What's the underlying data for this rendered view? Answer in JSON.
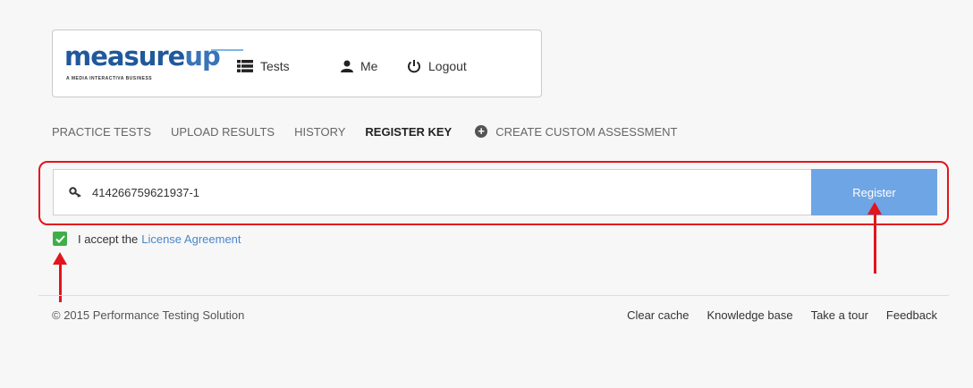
{
  "brand": {
    "logo_text_main": "measure",
    "logo_text_accent": "up",
    "logo_tagline": "A MEDIA INTERACTIVA BUSINESS"
  },
  "navbar": {
    "tests_label": "Tests",
    "me_label": "Me",
    "logout_label": "Logout"
  },
  "subnav": {
    "practice_tests": "PRACTICE TESTS",
    "upload_results": "UPLOAD RESULTS",
    "history": "HISTORY",
    "register_key": "REGISTER KEY",
    "create_custom": "CREATE CUSTOM ASSESSMENT",
    "active": "REGISTER KEY"
  },
  "register": {
    "key_value": "414266759621937-1",
    "button_label": "Register"
  },
  "accept": {
    "checked": true,
    "prefix": "I accept the",
    "link_label": "License Agreement"
  },
  "footer": {
    "copyright": "© 2015 Performance Testing Solution",
    "links": [
      "Clear cache",
      "Knowledge base",
      "Take a tour",
      "Feedback"
    ]
  },
  "colors": {
    "accent_blue": "#6ea5e4",
    "annotation_red": "#e3141d",
    "checkbox_green": "#3fae49",
    "link_blue": "#4a86c8"
  }
}
